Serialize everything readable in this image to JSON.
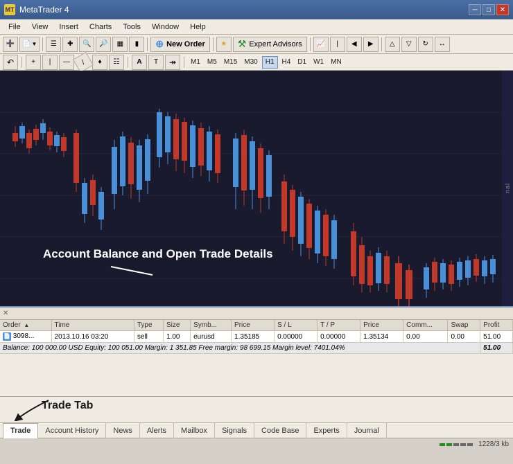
{
  "titlebar": {
    "title": "MetaTrader 4",
    "logo": "MT"
  },
  "menu": {
    "items": [
      "File",
      "View",
      "Insert",
      "Charts",
      "Tools",
      "Window",
      "Help"
    ]
  },
  "toolbar1": {
    "new_order": "New Order",
    "expert_advisors": "Expert Advisors"
  },
  "toolbar2": {
    "timeframes": [
      "M1",
      "M5",
      "M15",
      "M30",
      "H1",
      "H4",
      "D1",
      "W1",
      "MN"
    ],
    "active_tf": "H1"
  },
  "chart": {
    "annotation": "Account Balance and Open Trade Details"
  },
  "terminal": {
    "columns": [
      "Order",
      "Time",
      "Type",
      "Size",
      "Symb...",
      "Price",
      "S / L",
      "T / P",
      "Price",
      "Comm...",
      "Swap",
      "Profit"
    ],
    "trade_row": {
      "order": "3098...",
      "time": "2013.10.16 03:20",
      "type": "sell",
      "size": "1.00",
      "symbol": "eurusd",
      "price_open": "1.35185",
      "sl": "0.00000",
      "tp": "0.00000",
      "price_current": "1.35134",
      "comm": "0.00",
      "swap": "0.00",
      "profit": "51.00"
    },
    "balance_row": "Balance: 100 000.00 USD   Equity: 100 051.00   Margin: 1 351.85   Free margin: 98 699.15   Margin level: 7401.04%",
    "balance_right": "51.00"
  },
  "tabs": {
    "items": [
      "Trade",
      "Account History",
      "News",
      "Alerts",
      "Mailbox",
      "Signals",
      "Code Base",
      "Experts",
      "Journal"
    ],
    "active": "Trade"
  },
  "annotations": {
    "trade_tab_label": "Trade Tab"
  },
  "statusbar": {
    "memory": "1228/3 kb"
  }
}
